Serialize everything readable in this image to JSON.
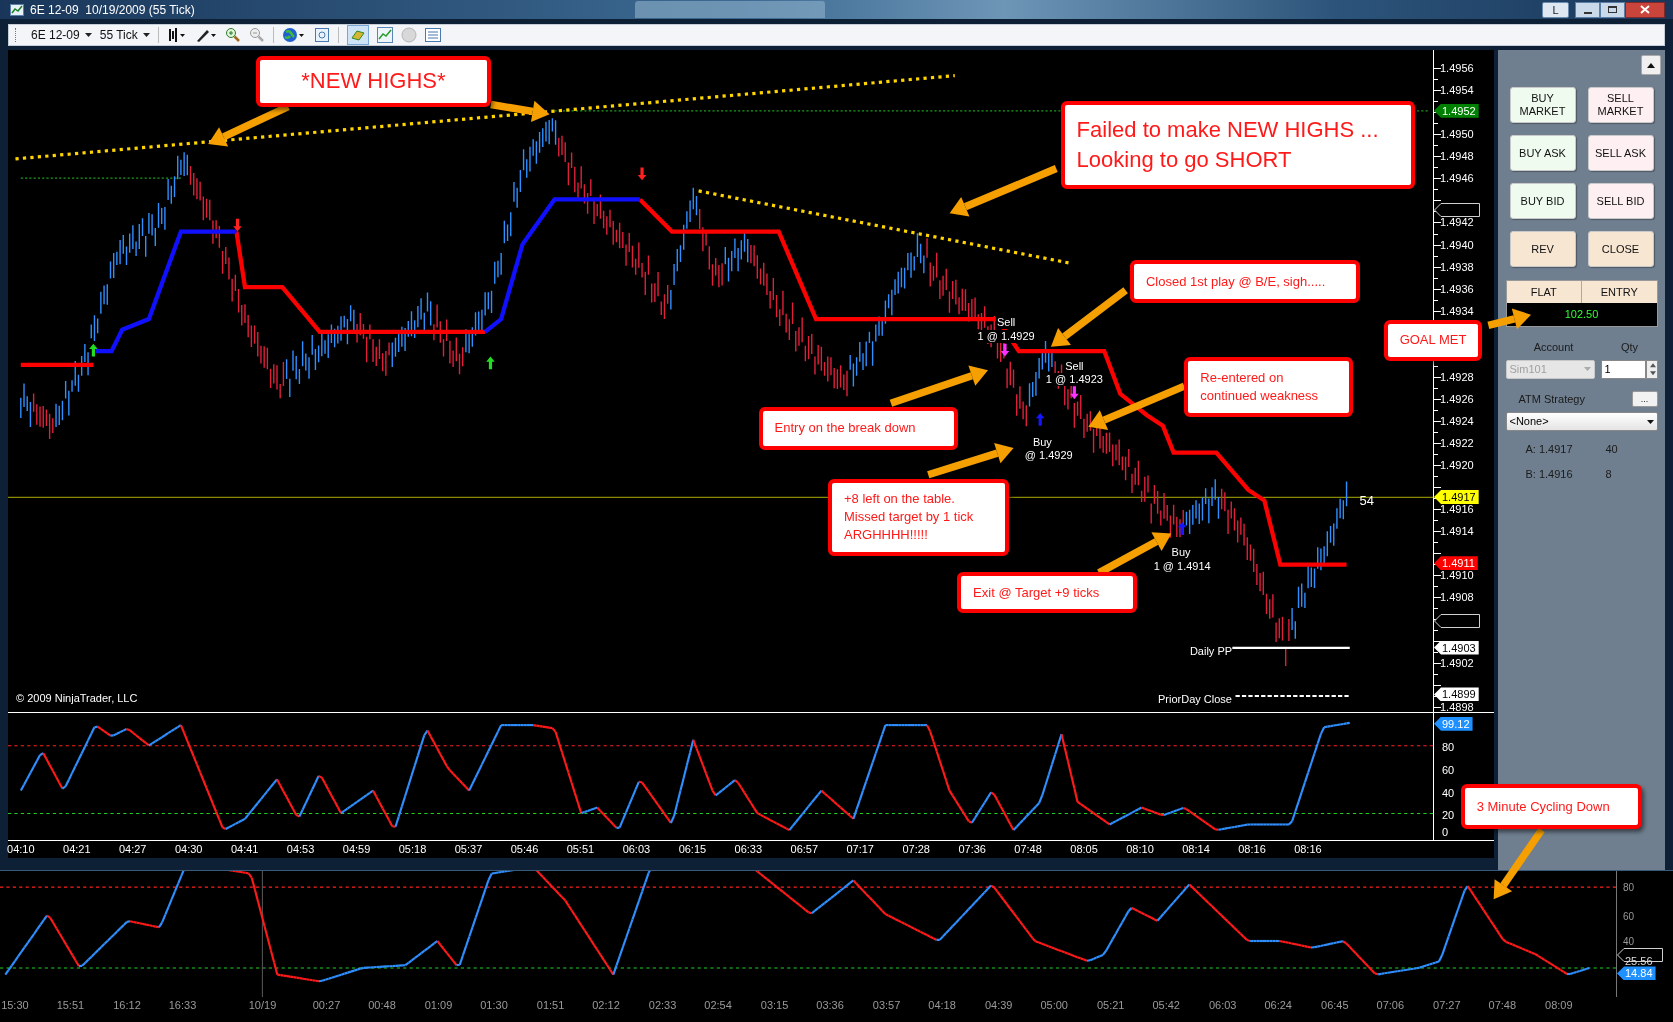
{
  "window": {
    "title": "6E 12-09  10/19/2009 (55 Tick)",
    "title_button": "L"
  },
  "toolbar": {
    "instrument": "6E 12-09",
    "interval": "55 Tick"
  },
  "price_panel": {
    "copyright": "© 2009 NinjaTrader, LLC",
    "axis_labels": [
      "1.4956",
      "1.4954",
      "1.4950",
      "1.4948",
      "1.4946",
      "1.4942",
      "1.4940",
      "1.4938",
      "1.4936",
      "1.4934",
      "1.4928",
      "1.4926",
      "1.4924",
      "1.4922",
      "1.4920",
      "1.4916",
      "1.4914",
      "1.4910",
      "1.4908",
      "1.4902",
      "1.4898"
    ],
    "markers": [
      {
        "kind": "filled",
        "label": "1.4952",
        "color": "#008000"
      },
      {
        "kind": "outline"
      },
      {
        "kind": "filled",
        "label": "1.4917",
        "color": "#ffff00"
      },
      {
        "kind": "filled",
        "label": "1.4911",
        "color": "#ff0000"
      },
      {
        "kind": "outline"
      },
      {
        "kind": "filled",
        "label": "1.4903",
        "color": "#ffffff"
      },
      {
        "kind": "filled",
        "label": "1.4899",
        "color": "#ffffff"
      }
    ],
    "chart_labels": [
      "Sell",
      "1 @ 1.4929",
      "Sell",
      "1 @ 1.4923",
      "Buy",
      "@ 1.4929",
      "Buy",
      "1 @ 1.4914",
      "54",
      "Daily PP",
      "PriorDay Close"
    ],
    "callouts": [
      {
        "lines": [
          "*NEW HIGHS*"
        ]
      },
      {
        "lines": [
          "Failed to make NEW HIGHS ...",
          "Looking to go SHORT"
        ]
      },
      {
        "lines": [
          "Closed 1st play @ B/E, sigh....."
        ]
      },
      {
        "lines": [
          "GOAL MET"
        ]
      },
      {
        "lines": [
          "Re-entered on",
          "continued weakness"
        ]
      },
      {
        "lines": [
          "Entry on the break down"
        ]
      },
      {
        "lines": [
          "+8 left on the table.",
          "Missed target by 1 tick",
          "ARGHHHH!!!!!"
        ]
      },
      {
        "lines": [
          "Exit @ Target +9 ticks"
        ]
      },
      {
        "lines": [
          "3 Minute Cycling Down"
        ]
      }
    ]
  },
  "oscillator": {
    "axis_labels": [
      "80",
      "60",
      "40",
      "20",
      "0"
    ],
    "marker": {
      "label": "99.12",
      "color": "#1e90ff"
    }
  },
  "time_axis": {
    "labels": [
      "04:10",
      "04:21",
      "04:27",
      "04:30",
      "04:41",
      "04:53",
      "04:59",
      "05:18",
      "05:37",
      "05:46",
      "05:51",
      "06:03",
      "06:15",
      "06:33",
      "06:57",
      "07:17",
      "07:28",
      "07:36",
      "07:48",
      "08:05",
      "08:10",
      "08:14",
      "08:16",
      "08:16"
    ]
  },
  "lower_chart": {
    "axis_labels": [
      "80",
      "60",
      "40"
    ],
    "markers": [
      {
        "kind": "outline",
        "label": "25.56"
      },
      {
        "kind": "filled",
        "label": "14.84",
        "color": "#1e90ff"
      }
    ],
    "time_labels": [
      "15:30",
      "15:51",
      "16:12",
      "16:33",
      "10/19",
      "00:27",
      "00:48",
      "01:09",
      "01:30",
      "01:51",
      "02:12",
      "02:33",
      "02:54",
      "03:15",
      "03:36",
      "03:57",
      "04:18",
      "04:39",
      "05:00",
      "05:21",
      "05:42",
      "06:03",
      "06:24",
      "06:45",
      "07:06",
      "07:27",
      "07:48",
      "08:09"
    ]
  },
  "order_panel": {
    "buttons": [
      {
        "label": "BUY MARKET",
        "kind": "buy"
      },
      {
        "label": "SELL MARKET",
        "kind": "sell"
      },
      {
        "label": "BUY ASK",
        "kind": "buy"
      },
      {
        "label": "SELL ASK",
        "kind": "sell"
      },
      {
        "label": "BUY BID",
        "kind": "buy"
      },
      {
        "label": "SELL BID",
        "kind": "sell"
      },
      {
        "label": "REV",
        "kind": "action"
      },
      {
        "label": "CLOSE",
        "kind": "action"
      }
    ],
    "position": {
      "columns": [
        "FLAT",
        "ENTRY"
      ],
      "value": "102.50"
    },
    "account": {
      "label": "Account",
      "value": "Sim101",
      "disabled": true
    },
    "quantity": {
      "label": "Qty",
      "value": "1"
    },
    "atm_strategy": {
      "label": "ATM Strategy",
      "button": "...",
      "value": "<None>"
    },
    "quotes": [
      {
        "label": "A: 1.4917",
        "size": "40"
      },
      {
        "label": "B: 1.4916",
        "size": "8"
      }
    ]
  }
}
